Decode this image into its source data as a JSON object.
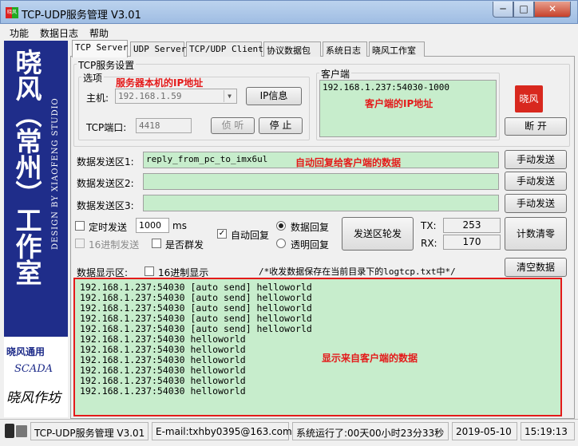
{
  "window": {
    "title": "TCP-UDP服务管理 V3.01",
    "icon_text": "晓风",
    "min": "─",
    "max": "□",
    "close": "✕"
  },
  "menu": [
    "功能",
    "数据日志",
    "帮助"
  ],
  "banner": {
    "main": "晓风（常州）工作室",
    "sub": "DESIGN BY XIAOFENG STUDIO",
    "scada1": "晓风通用",
    "scada2": "SCADA",
    "scada3": "晓风作坊"
  },
  "tabs": [
    "TCP Server",
    "UDP Server",
    "TCP/UDP Client",
    "协议数据包",
    "系统日志",
    "晓风工作室"
  ],
  "tcp_settings": {
    "group_label": "TCP服务设置",
    "options_label": "选项",
    "host_label": "主机:",
    "host_value": "192.168.1.59",
    "ip_info_button": "IP信息",
    "port_label": "TCP端口:",
    "port_value": "4418",
    "listen_button": "侦 听",
    "stop_button": "停 止",
    "annotation_host": "服务器本机的IP地址"
  },
  "client": {
    "group_label": "客户端",
    "client_value": "192.168.1.237:54030-1000",
    "annotation_client": "客户端的IP地址",
    "seal_text": "晓风",
    "disconnect_button": "断 开"
  },
  "send": {
    "area1_label": "数据发送区1:",
    "area1_value": "reply_from_pc_to_imx6ul",
    "area1_annotation": "自动回复给客户端的数据",
    "area2_label": "数据发送区2:",
    "area2_value": "",
    "area3_label": "数据发送区3:",
    "area3_value": "",
    "manual_send": "手动发送"
  },
  "options": {
    "timed_send": "定时发送",
    "timed_ms": "1000",
    "ms_unit": "ms",
    "hex_send": "16进制发送",
    "broadcast": "是否群发",
    "auto_reply": "自动回复",
    "data_reply": "数据回复",
    "transparent_reply": "透明回复",
    "rotate_button": "发送区轮发",
    "tx_label": "TX:",
    "tx_value": "253",
    "rx_label": "RX:",
    "rx_value": "170",
    "count_clear": "计数清零"
  },
  "display": {
    "label": "数据显示区:",
    "hex_display": "16进制显示",
    "note": "/*收发数据保存在当前目录下的logtcp.txt中*/",
    "clear_button": "清空数据",
    "annotation": "显示来自客户端的数据",
    "lines": [
      "192.168.1.237:54030 [auto send] helloworld",
      "192.168.1.237:54030 [auto send] helloworld",
      "192.168.1.237:54030 [auto send] helloworld",
      "192.168.1.237:54030 [auto send] helloworld",
      "192.168.1.237:54030 [auto send] helloworld",
      "192.168.1.237:54030 helloworld",
      "192.168.1.237:54030 helloworld",
      "192.168.1.237:54030 helloworld",
      "192.168.1.237:54030 helloworld",
      "192.168.1.237:54030 helloworld",
      "192.168.1.237:54030 helloworld"
    ]
  },
  "status": {
    "app": "TCP-UDP服务管理 V3.01",
    "email": "E-mail:txhby0395@163.com",
    "uptime": "系统运行了:00天00小时23分33秒",
    "date": "2019-05-10",
    "time": "15:19:13"
  },
  "colors": {
    "banner_bg": "#1f2d8a",
    "green_field": "#c7edcc",
    "annotation_red": "#e41a1a"
  }
}
